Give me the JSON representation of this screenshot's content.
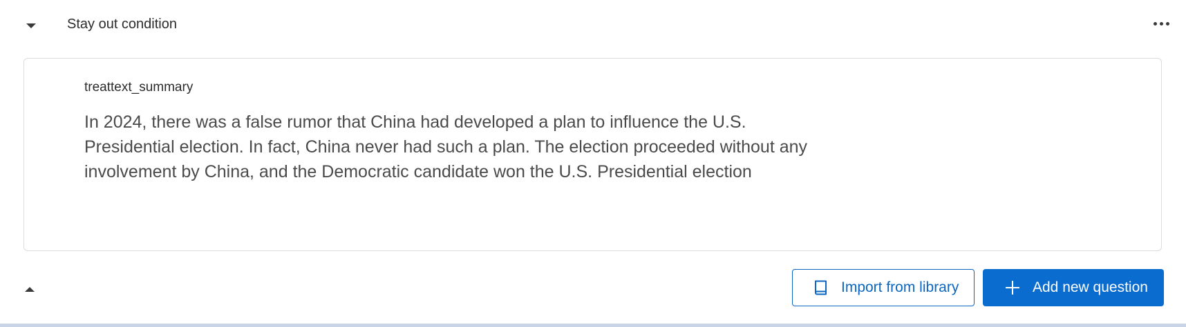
{
  "block": {
    "title": "Stay out condition",
    "menu_icon": "more-horizontal-icon",
    "collapse_icon": "caret-down-icon"
  },
  "question": {
    "id": "treattext_summary",
    "text": "In 2024, there was a false rumor that China had developed a plan to influence the U.S. Presidential election. In fact, China never had such a plan. The election proceeded without any involvement by China, and the Democratic candidate won the U.S. Presidential election"
  },
  "footer": {
    "toggle_icon": "caret-up-icon",
    "import_label": "Import from library",
    "import_icon": "book-icon",
    "add_label": "Add new question",
    "add_icon": "plus-icon"
  },
  "colors": {
    "accent": "#0a6ccf",
    "border": "#dcdcdc",
    "text": "#4a4a4a"
  }
}
